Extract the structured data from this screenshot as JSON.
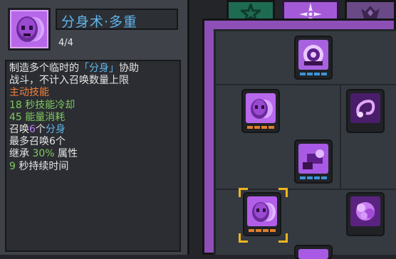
{
  "skill": {
    "name": "分身术·多重",
    "level": "4/4",
    "description": [
      [
        {
          "t": "制造多个临时的",
          "c": ""
        },
        {
          "t": "「分身」",
          "c": "c-blue"
        },
        {
          "t": "协助",
          "c": ""
        }
      ],
      [
        {
          "t": "战斗，不计入召唤数量上限",
          "c": ""
        }
      ],
      [
        {
          "t": "主动技能",
          "c": "c-orange"
        }
      ],
      [
        {
          "t": "18 秒技能冷却",
          "c": "c-green"
        }
      ],
      [
        {
          "t": "45 能量消耗",
          "c": "c-green"
        }
      ],
      [
        {
          "t": "召唤",
          "c": ""
        },
        {
          "t": "6",
          "c": "c-purple"
        },
        {
          "t": "个",
          "c": ""
        },
        {
          "t": "分身",
          "c": "c-blue"
        }
      ],
      [
        {
          "t": "最多召唤6个",
          "c": ""
        }
      ],
      [
        {
          "t": "继承 ",
          "c": ""
        },
        {
          "t": "30%",
          "c": "c-green"
        },
        {
          "t": " 属性",
          "c": ""
        }
      ],
      [
        {
          "t": "9",
          "c": "c-green"
        },
        {
          "t": " 秒持续时间",
          "c": ""
        }
      ]
    ]
  },
  "tabs": [
    {
      "icon": "star-icon",
      "color": "#1f6b52"
    },
    {
      "icon": "compass-star-icon",
      "color": "#a45ad6",
      "active": true
    },
    {
      "icon": "crown-emblem-icon",
      "color": "#6a4a86"
    }
  ],
  "tree_nodes": [
    {
      "name": "node-portal",
      "pips": "blue"
    },
    {
      "name": "node-clone",
      "pips": "orange"
    },
    {
      "name": "node-swirl",
      "pips": "none"
    },
    {
      "name": "node-cannon",
      "pips": "blue"
    },
    {
      "name": "node-clone-multi",
      "pips": "orange",
      "selected": true
    },
    {
      "name": "node-burst",
      "pips": "none"
    }
  ],
  "colors": {
    "accent_blue": "#5fb6ea",
    "accent_orange": "#f4823a",
    "accent_green": "#7ec95e",
    "node_purple": "#b25ee8"
  }
}
